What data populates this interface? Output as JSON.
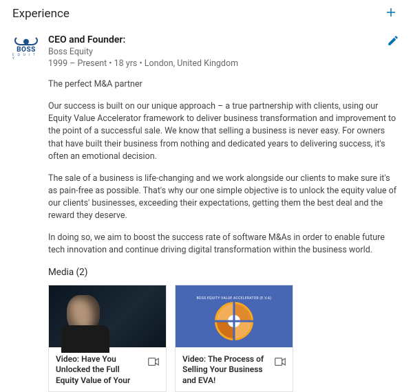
{
  "section_title": "Experience",
  "experience": {
    "title": "CEO and Founder:",
    "company": "Boss Equity",
    "dates": "1999 – Present  •  18 yrs  •  London, United Kingdom",
    "logo": {
      "text": "BOSS",
      "sub": "E Q U I T Y"
    },
    "paragraphs": [
      "The perfect M&A partner",
      "Our success is built on our unique approach – a true partnership with clients, using our Equity Value Accelerator framework to deliver business transformation and improvement to the point of a successful sale. We know that selling a business is never easy. For owners that have built their business from nothing and dedicated years to delivering success, it's often an emotional decision.",
      "The sale of a business is life-changing and we work alongside our clients to make sure it's as pain-free as possible. That's why our one simple objective is to unlock the equity value of our clients' businesses, exceeding their expectations, getting them the best deal and the reward they deserve.",
      "In doing so, we aim to boost the success rate of software M&As in order to enable future tech innovation and continue driving digital transformation within the business world."
    ],
    "media_header": "Media (2)",
    "media": [
      {
        "title": "Video: Have You Unlocked the Full Equity Value of Your",
        "thumb_text": ""
      },
      {
        "title": "Video: The Process of Selling Your Business and EVA!",
        "thumb_text": "BOSS EQUITY VALUE ACCELERATOR (E.V.A)"
      }
    ]
  }
}
